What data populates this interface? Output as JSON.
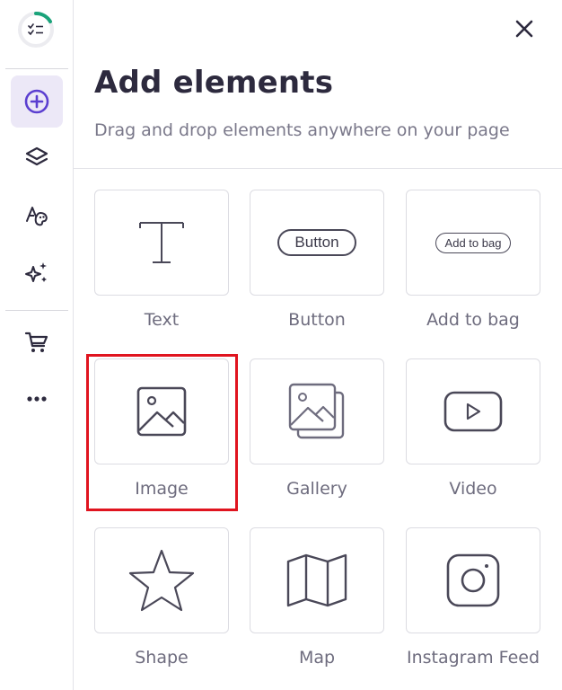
{
  "sidebar": {
    "items": [
      {
        "icon": "add-circle-icon",
        "active": true
      },
      {
        "icon": "layers-icon"
      },
      {
        "icon": "typography-palette-icon"
      },
      {
        "icon": "sparkles-icon"
      },
      {
        "icon": "shopping-cart-icon"
      },
      {
        "icon": "more-horizontal-icon"
      }
    ]
  },
  "panel": {
    "title": "Add elements",
    "subtitle": "Drag and drop elements anywhere on your page",
    "close_icon": "close-icon"
  },
  "elements": [
    {
      "label": "Text",
      "icon": "text-icon"
    },
    {
      "label": "Button",
      "icon": "button-preview",
      "preview_text": "Button"
    },
    {
      "label": "Add to bag",
      "icon": "add-to-bag-preview",
      "preview_text": "Add to bag"
    },
    {
      "label": "Image",
      "icon": "image-icon",
      "highlighted": true
    },
    {
      "label": "Gallery",
      "icon": "gallery-icon"
    },
    {
      "label": "Video",
      "icon": "video-icon"
    },
    {
      "label": "Shape",
      "icon": "star-icon"
    },
    {
      "label": "Map",
      "icon": "map-icon"
    },
    {
      "label": "Instagram Feed",
      "icon": "instagram-icon"
    }
  ],
  "colors": {
    "accent": "#5b3fd0",
    "active_bg": "#ece8f7",
    "highlight": "#e0141f",
    "progress": "#1aa37a"
  }
}
